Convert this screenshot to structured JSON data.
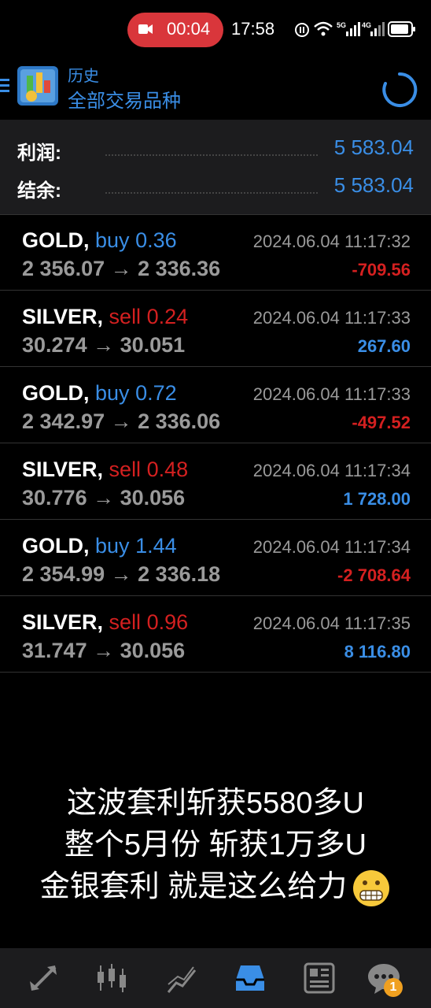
{
  "status": {
    "recording_time": "00:04",
    "clock": "17:58"
  },
  "header": {
    "subtitle": "历史",
    "title": "全部交易品种"
  },
  "summary": {
    "profit_label": "利润:",
    "profit_value": "5 583.04",
    "balance_label": "结余:",
    "balance_value": "5 583.04"
  },
  "trades": [
    {
      "symbol": "GOLD,",
      "side": "buy",
      "volume": "0.36",
      "prices": "2 356.07 → 2 336.36",
      "time": "2024.06.04 11:17:32",
      "pl": "-709.56"
    },
    {
      "symbol": "SILVER,",
      "side": "sell",
      "volume": "0.24",
      "prices": "30.274 → 30.051",
      "time": "2024.06.04 11:17:33",
      "pl": "267.60"
    },
    {
      "symbol": "GOLD,",
      "side": "buy",
      "volume": "0.72",
      "prices": "2 342.97 → 2 336.06",
      "time": "2024.06.04 11:17:33",
      "pl": "-497.52"
    },
    {
      "symbol": "SILVER,",
      "side": "sell",
      "volume": "0.48",
      "prices": "30.776 → 30.056",
      "time": "2024.06.04 11:17:34",
      "pl": "1 728.00"
    },
    {
      "symbol": "GOLD,",
      "side": "buy",
      "volume": "1.44",
      "prices": "2 354.99 → 2 336.18",
      "time": "2024.06.04 11:17:34",
      "pl": "-2 708.64"
    },
    {
      "symbol": "SILVER,",
      "side": "sell",
      "volume": "0.96",
      "prices": "31.747 → 30.056",
      "time": "2024.06.04 11:17:35",
      "pl": "8 116.80"
    }
  ],
  "caption": {
    "line1": "这波套利斩获5580多U",
    "line2": "整个5月份 斩获1万多U",
    "line3": "金银套利  就是这么给力"
  },
  "nav": {
    "items": [
      "quotes-icon",
      "chart-icon",
      "trade-icon",
      "history-icon",
      "news-icon",
      "messages-icon"
    ],
    "badge": "1"
  },
  "colors": {
    "accent": "#3a8ee6",
    "loss": "#d42020",
    "recording": "#d9363b"
  }
}
